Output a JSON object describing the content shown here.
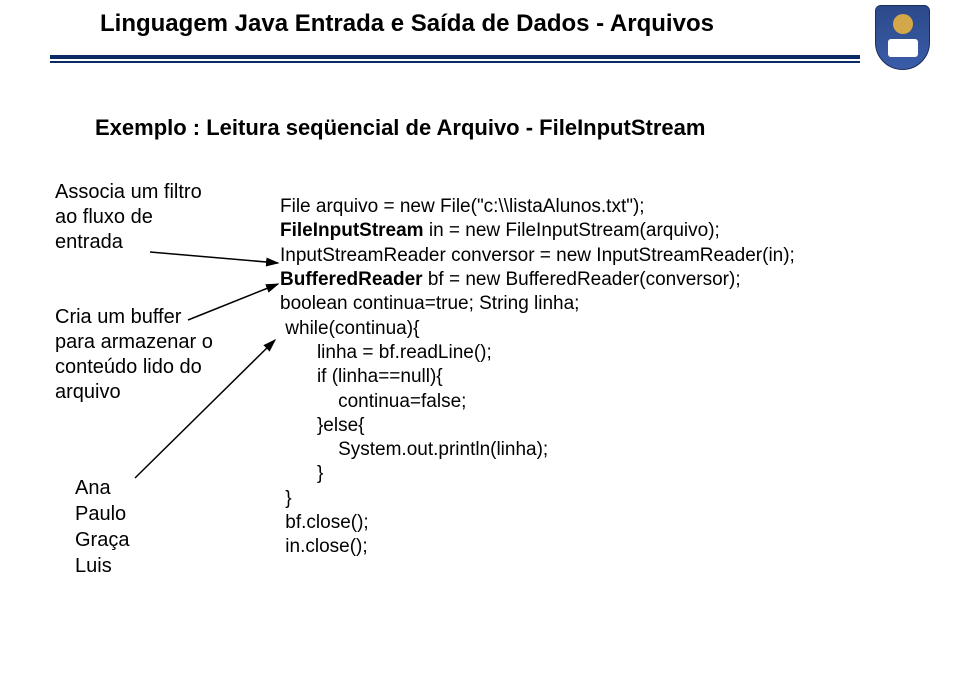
{
  "header": {
    "title": "Linguagem Java Entrada e Saída de Dados - Arquivos"
  },
  "subtitle": "Exemplo : Leitura seqüencial de Arquivo - FileInputStream",
  "annotations": {
    "a1_l1": "Associa um filtro",
    "a1_l2": "ao fluxo de",
    "a1_l3": "entrada",
    "a2_l1": "Cria um buffer",
    "a2_l2": "para armazenar o",
    "a2_l3": "conteúdo lido do",
    "a2_l4": "arquivo"
  },
  "output": {
    "l1": "Ana",
    "l2": "Paulo",
    "l3": "Graça",
    "l4": "Luis"
  },
  "code": {
    "l1a": "File arquivo = new File(\"c:\\\\listaAlunos.txt\");",
    "l2a": "FileInputStream",
    "l2b": " in = new FileInputStream(arquivo);",
    "l3a": "InputStreamReader conversor = new InputStreamReader(in);",
    "l4a": "BufferedReader",
    "l4b": " bf = new BufferedReader(conversor);",
    "l5a": "boolean continua=true; String linha;",
    "l6a": " while(continua){",
    "l7a": "       linha = bf.readLine();",
    "l8a": "       if (linha==null){",
    "l9a": "           continua=false;",
    "l10a": "       }else{",
    "l11a": "           System.out.println(linha);",
    "l12a": "       }",
    "l13a": " }",
    "l14a": " bf.close();",
    "l15a": " in.close();"
  }
}
